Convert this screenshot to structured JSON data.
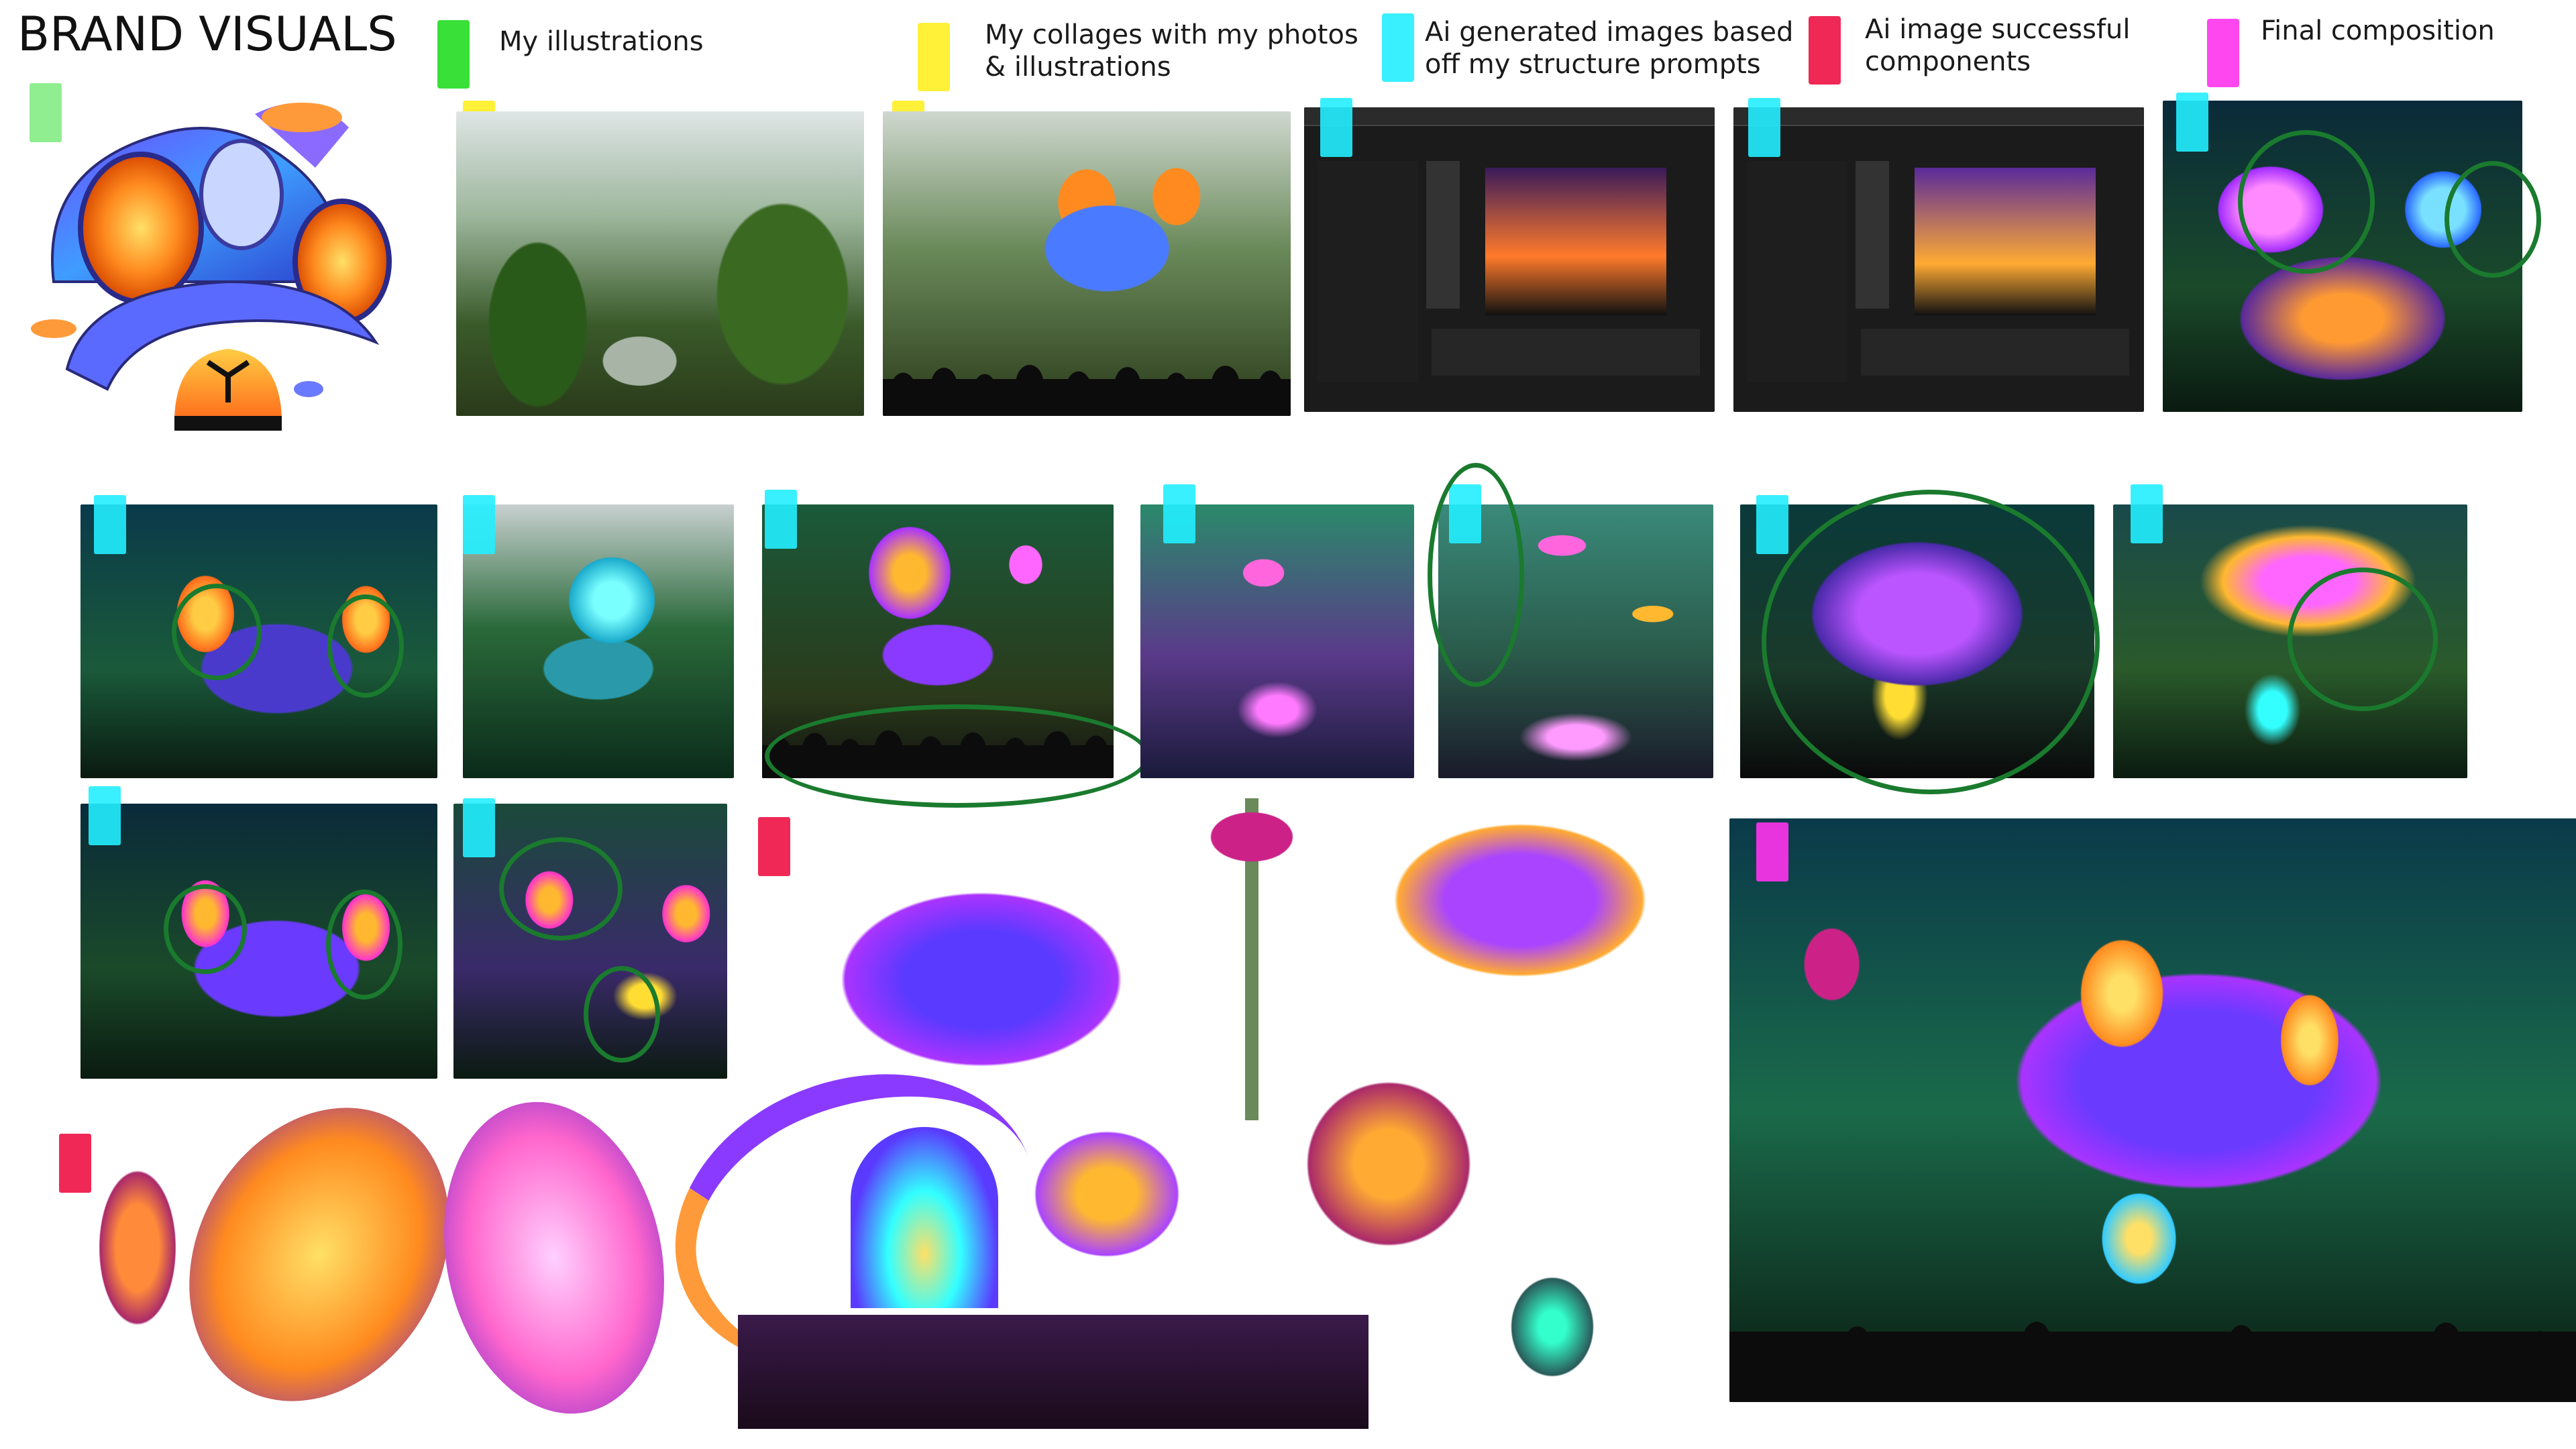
{
  "page": {
    "title": "BRAND VISUALS"
  },
  "legend": [
    {
      "label": "My illustrations",
      "color": "#22dd22"
    },
    {
      "label": "My collages with my photos & illustrations",
      "color": "#ffee22"
    },
    {
      "label": "Ai generated images based off my structure prompts",
      "color": "#22eeff"
    },
    {
      "label": "Ai image successful components",
      "color": "#ee1144"
    },
    {
      "label": "Final composition",
      "color": "#ff33ee"
    }
  ],
  "colors": {
    "illustration_tag": "#22dd22",
    "collage_tag": "#ffee22",
    "ai_tag": "#22eeff",
    "component_tag": "#ee1144",
    "final_tag": "#ff33ee",
    "annotation_circle": "#1a7a2e"
  },
  "sections": {
    "illustration": "mushroom-stage-illustration",
    "photo": "tropical-greenhouse-photo",
    "collage": "mushroom-collage-with-crowd",
    "ui_screens": [
      "adobe-firefly-screen-1",
      "adobe-firefly-screen-2"
    ],
    "ai_images": 11,
    "components": 10,
    "final": "final-composition-image"
  }
}
